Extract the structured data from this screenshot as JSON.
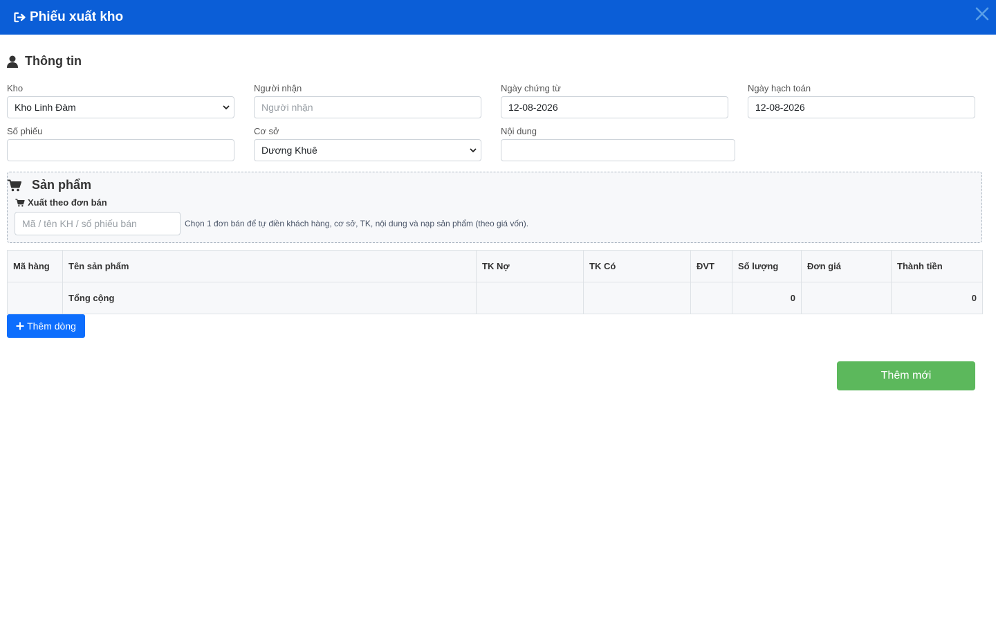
{
  "header": {
    "title": "Phiếu xuất kho"
  },
  "info": {
    "title": "Thông tin",
    "kho": {
      "label": "Kho",
      "value": "Kho Linh Đàm"
    },
    "nguoi_nhan": {
      "label": "Người nhận",
      "placeholder": "Người nhận",
      "value": ""
    },
    "ngay_chung_tu": {
      "label": "Ngày chứng từ",
      "value": "12-08-2026"
    },
    "ngay_hach_toan": {
      "label": "Ngày hạch toán",
      "value": "12-08-2026"
    },
    "so_phieu": {
      "label": "Số phiếu",
      "value": ""
    },
    "co_so": {
      "label": "Cơ sở",
      "value": "Dương Khuê"
    },
    "noi_dung": {
      "label": "Nội dung",
      "value": ""
    }
  },
  "products": {
    "title": "Sản phẩm",
    "subtitle": "Xuất theo đơn bán",
    "search_placeholder": "Mã / tên KH / số phiếu bán",
    "hint": "Chọn 1 đơn bán để tự điền khách hàng, cơ sở, TK, nội dung và nạp sản phẩm (theo giá vốn)."
  },
  "table": {
    "columns": [
      "Mã hàng",
      "Tên sản phẩm",
      "TK Nợ",
      "TK Có",
      "ĐVT",
      "Số lượng",
      "Đơn giá",
      "Thành tiền"
    ],
    "total_label": "Tổng cộng",
    "total_quantity": "0",
    "total_amount": "0"
  },
  "buttons": {
    "add_row": "Thêm dòng",
    "submit": "Thêm mới"
  },
  "colors": {
    "header": "#0b5ed7",
    "add_row": "#0d6efd",
    "submit": "#5cb85c"
  }
}
